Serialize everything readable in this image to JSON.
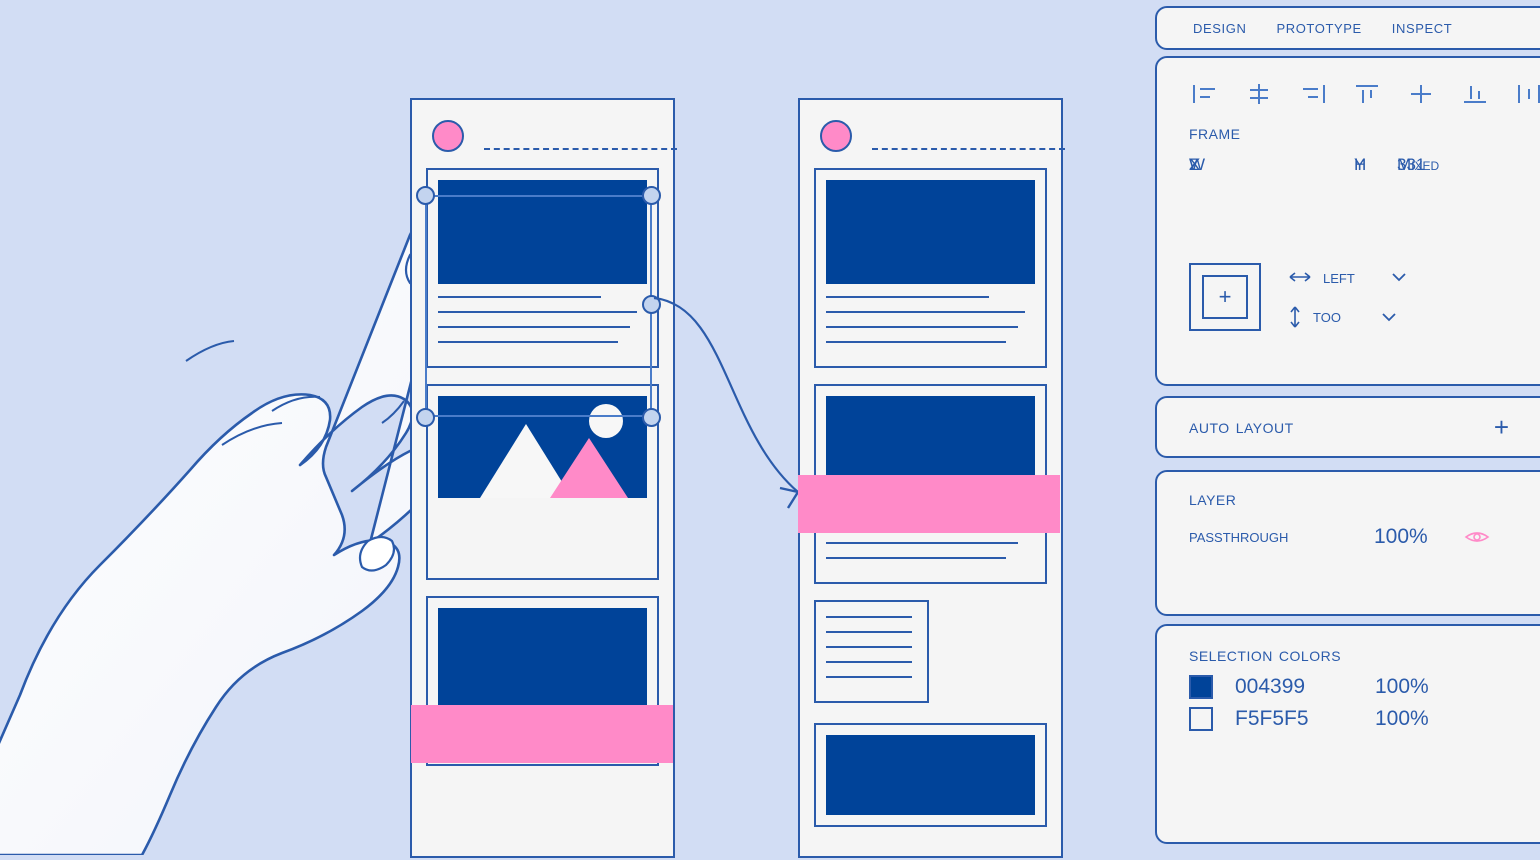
{
  "canvas": {
    "background_color": "#d2ddf4",
    "accent_blue": "#004399",
    "accent_pink": "#ff8ac8",
    "line_blue": "#2b5bab",
    "surface": "#f5f5f5"
  },
  "hand": {
    "label": "pointing-hand-illustration"
  },
  "mockups": {
    "left": {
      "name": "selected-artboard",
      "avatar": "pink-circle-avatar",
      "nav": "dashed-nav-line",
      "cards": [
        {
          "type": "image-text-card",
          "image": "blue-image-block",
          "lines": 4
        },
        {
          "type": "landscape-card",
          "image": "mountain-scene",
          "lines": 0
        },
        {
          "type": "image-text-card",
          "image": "blue-image-block",
          "lines": 2
        }
      ],
      "highlight_bar": "pink-overlay-bar"
    },
    "right": {
      "name": "target-artboard",
      "avatar": "pink-circle-avatar",
      "nav": "dashed-nav-line",
      "cards": [
        {
          "type": "image-text-card",
          "image": "blue-image-block",
          "lines": 4
        },
        {
          "type": "image-text-card",
          "image": "blue-image-block",
          "lines": 4
        },
        {
          "type": "text-card",
          "image": "",
          "lines": 5
        },
        {
          "type": "image-text-card",
          "image": "blue-image-block",
          "lines": 0
        }
      ],
      "highlight_bar": "pink-overlay-bar"
    },
    "connector": "curved-prototype-arrow"
  },
  "inspector": {
    "tabs": [
      {
        "label": "Design",
        "selected": true
      },
      {
        "label": "Prototype",
        "selected": false
      },
      {
        "label": "Inspect",
        "selected": false
      }
    ],
    "align_icons": [
      "align-left-icon",
      "align-horizontal-center-icon",
      "align-right-icon",
      "align-top-icon",
      "align-vertical-center-icon",
      "align-bottom-icon",
      "distribute-horizontal-icon"
    ],
    "frame": {
      "title": "Frame",
      "fields": [
        {
          "label": "X",
          "value": ""
        },
        {
          "label": "Y",
          "value": "Mixed"
        },
        {
          "label": "W",
          "value": ""
        },
        {
          "label": "H",
          "value": "331"
        },
        {
          "label": "Z",
          "value": ""
        }
      ],
      "constraints": {
        "widget": "constraints-widget",
        "horizontal": {
          "icon": "horizontal-arrows-icon",
          "value": "Left"
        },
        "vertical": {
          "icon": "vertical-arrows-icon",
          "value": "Too"
        }
      }
    },
    "auto_layout": {
      "title": "Auto layout",
      "add_label": "+"
    },
    "layer": {
      "title": "Layer",
      "blend_mode": "Passthrough",
      "opacity": "100%",
      "visibility_icon": "eye-icon"
    },
    "selection_colors": {
      "title": "Selection colors",
      "items": [
        {
          "hex": "004399",
          "opacity": "100%",
          "swatch": "#004399"
        },
        {
          "hex": "F5F5F5",
          "opacity": "100%",
          "swatch": "#f5f5f5"
        }
      ]
    }
  }
}
